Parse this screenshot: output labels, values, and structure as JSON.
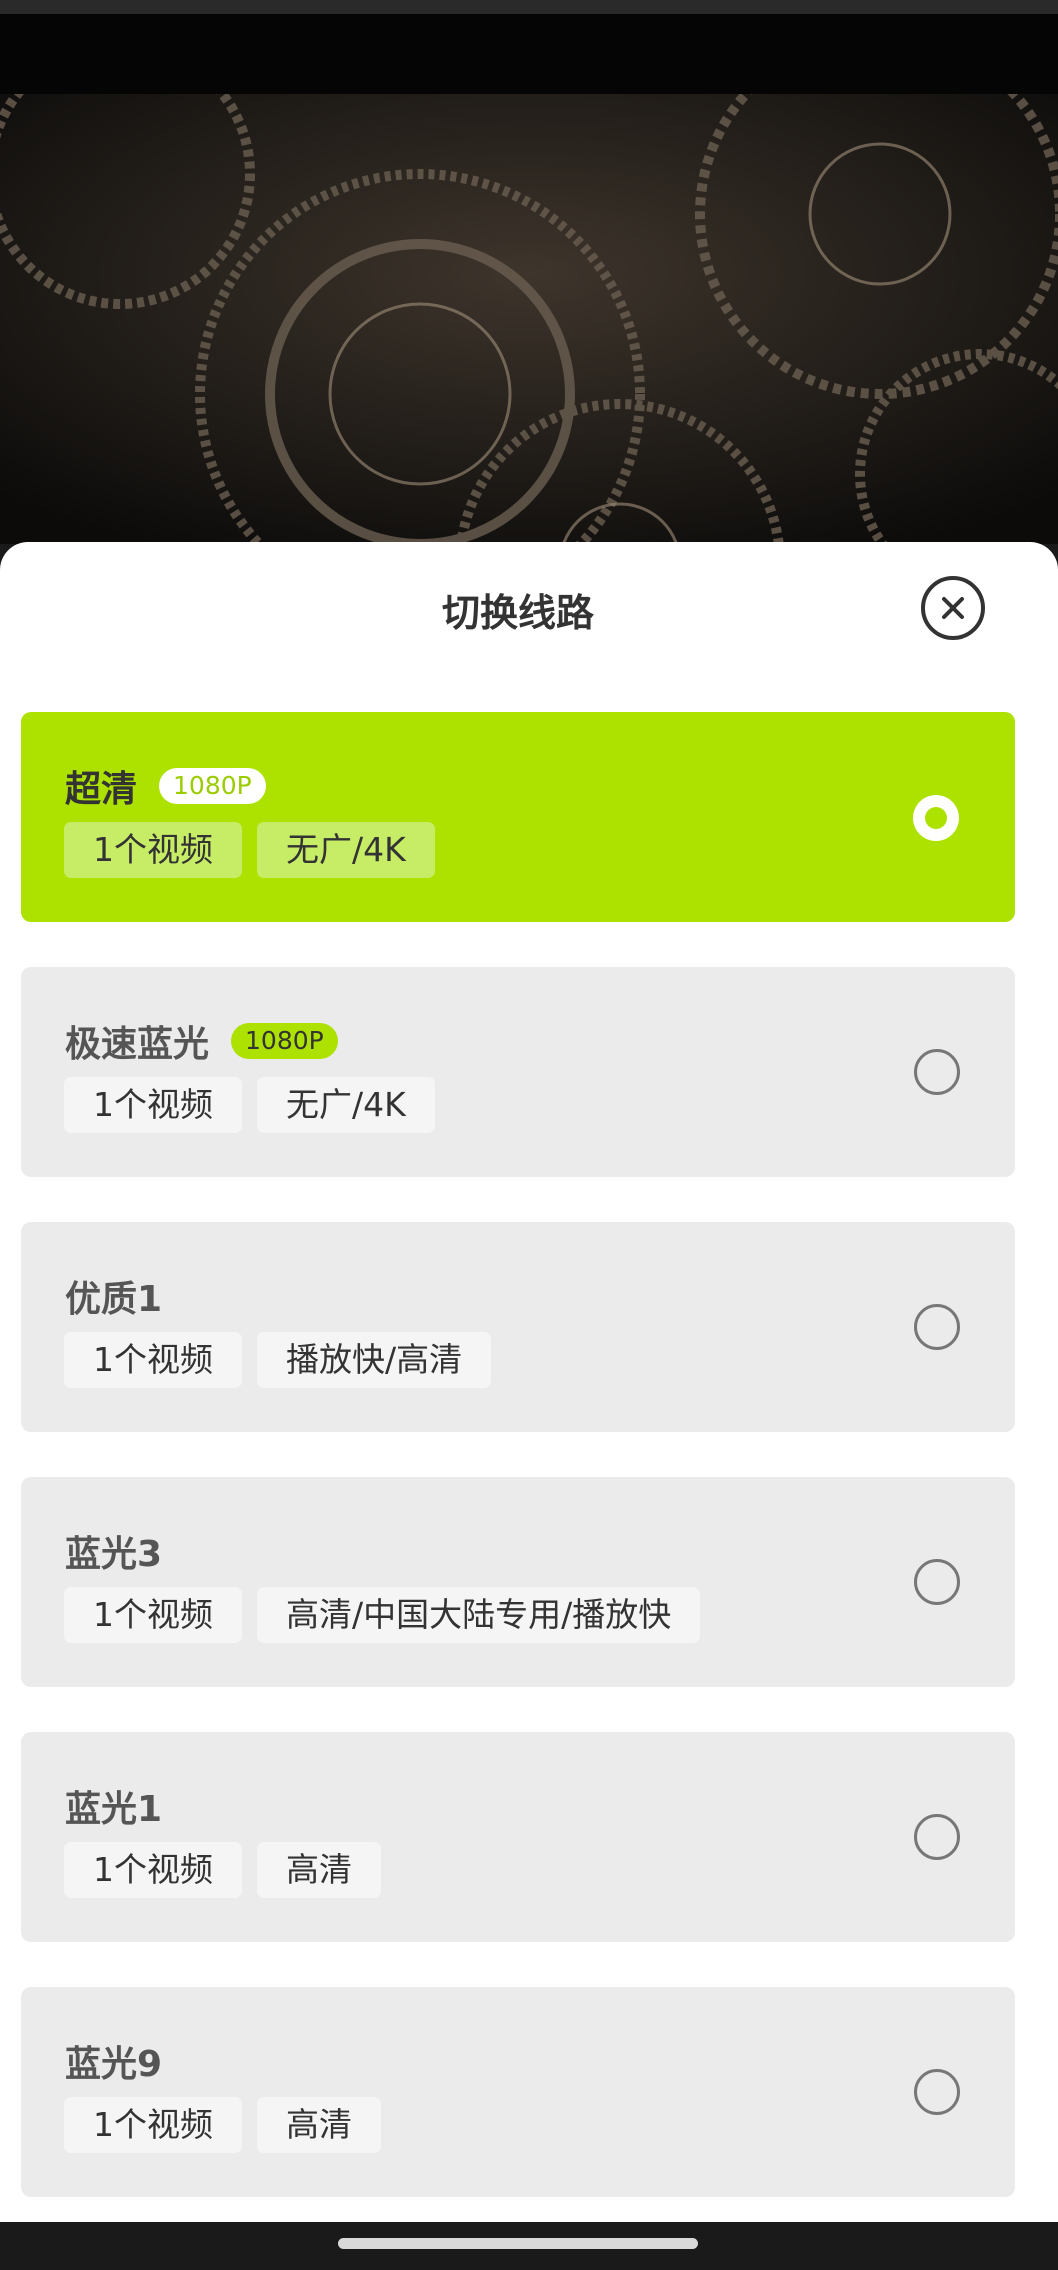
{
  "sheet": {
    "title": "切换线路"
  },
  "routes": [
    {
      "name": "超清",
      "badge": "1080P",
      "tags": [
        "1个视频",
        "无广/4K"
      ],
      "selected": true
    },
    {
      "name": "极速蓝光",
      "badge": "1080P",
      "tags": [
        "1个视频",
        "无广/4K"
      ],
      "selected": false
    },
    {
      "name": "优质1",
      "badge": "",
      "tags": [
        "1个视频",
        "播放快/高清"
      ],
      "selected": false
    },
    {
      "name": "蓝光3",
      "badge": "",
      "tags": [
        "1个视频",
        "高清/中国大陆专用/播放快"
      ],
      "selected": false
    },
    {
      "name": "蓝光1",
      "badge": "",
      "tags": [
        "1个视频",
        "高清"
      ],
      "selected": false
    },
    {
      "name": "蓝光9",
      "badge": "",
      "tags": [
        "1个视频",
        "高清"
      ],
      "selected": false
    }
  ],
  "icons": {
    "close": "close-icon",
    "radio_selected": "radio-selected-icon",
    "radio_empty": "radio-empty-icon"
  },
  "colors": {
    "accent": "#ace100",
    "card_bg": "#ebebeb",
    "text": "#333333"
  }
}
